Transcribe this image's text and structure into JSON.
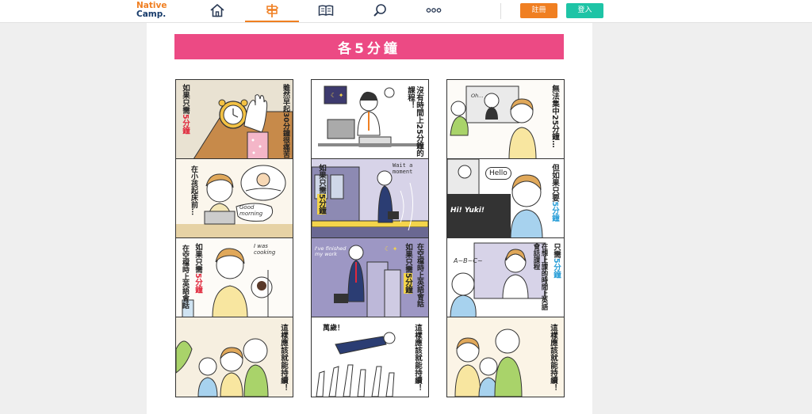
{
  "header": {
    "logo_line1": "Native",
    "logo_line2": "Camp.",
    "nav": [
      {
        "icon": "home-icon"
      },
      {
        "icon": "signpost-icon",
        "active": true
      },
      {
        "icon": "book-icon"
      },
      {
        "icon": "search-icon"
      },
      {
        "icon": "more-icon",
        "label": "ooo"
      }
    ],
    "signup_label": "註冊",
    "login_label": "登入"
  },
  "banner": {
    "title": "各5分鐘"
  },
  "colors": {
    "orange": "#f07f21",
    "teal": "#1ec4a6",
    "pink": "#ec4a84",
    "navy": "#163a6a"
  },
  "strip1": {
    "p1_a": "雖然早起30分鐘很痛苦",
    "p1_b_pre": "如果只需",
    "p1_b_hl": "5分鐘",
    "p2": "在小孩起床前…",
    "p2_bubble": "Good morning",
    "p3_a_pre": "如果只需",
    "p3_a_hl": "5分鐘",
    "p3_b": "在空檔時上英語會話",
    "p3_bubble": "I was cooking",
    "p4": "這樣應該就能持續！"
  },
  "strip2": {
    "p1": "沒有時間上25分鐘的課程！",
    "p2_pre": "如果只需",
    "p2_hl": "5分鐘",
    "p2_bubble": "Wait a moment",
    "p3_pre": "如果只需",
    "p3_hl": "5分鐘",
    "p3_b": "在空檔時上英語會話",
    "p3_bubble": "I've finished my work",
    "p4_shout": "萬歲！",
    "p4": "這樣應該就能持續！"
  },
  "strip3": {
    "p1": "無法集中25分鐘…",
    "p1_bubble": "Oh…",
    "p2_pre": "但如果只要",
    "p2_hl": "5分鐘",
    "p2_bubble1": "Hello",
    "p2_bubble2": "Hi! Yuki!",
    "p3_pre": "只需",
    "p3_hl": "5分鐘",
    "p3_b": "在想上課的時間上英語會話課程",
    "p3_bubble": "A~B~C~",
    "p4": "這樣應該就能持續！"
  }
}
